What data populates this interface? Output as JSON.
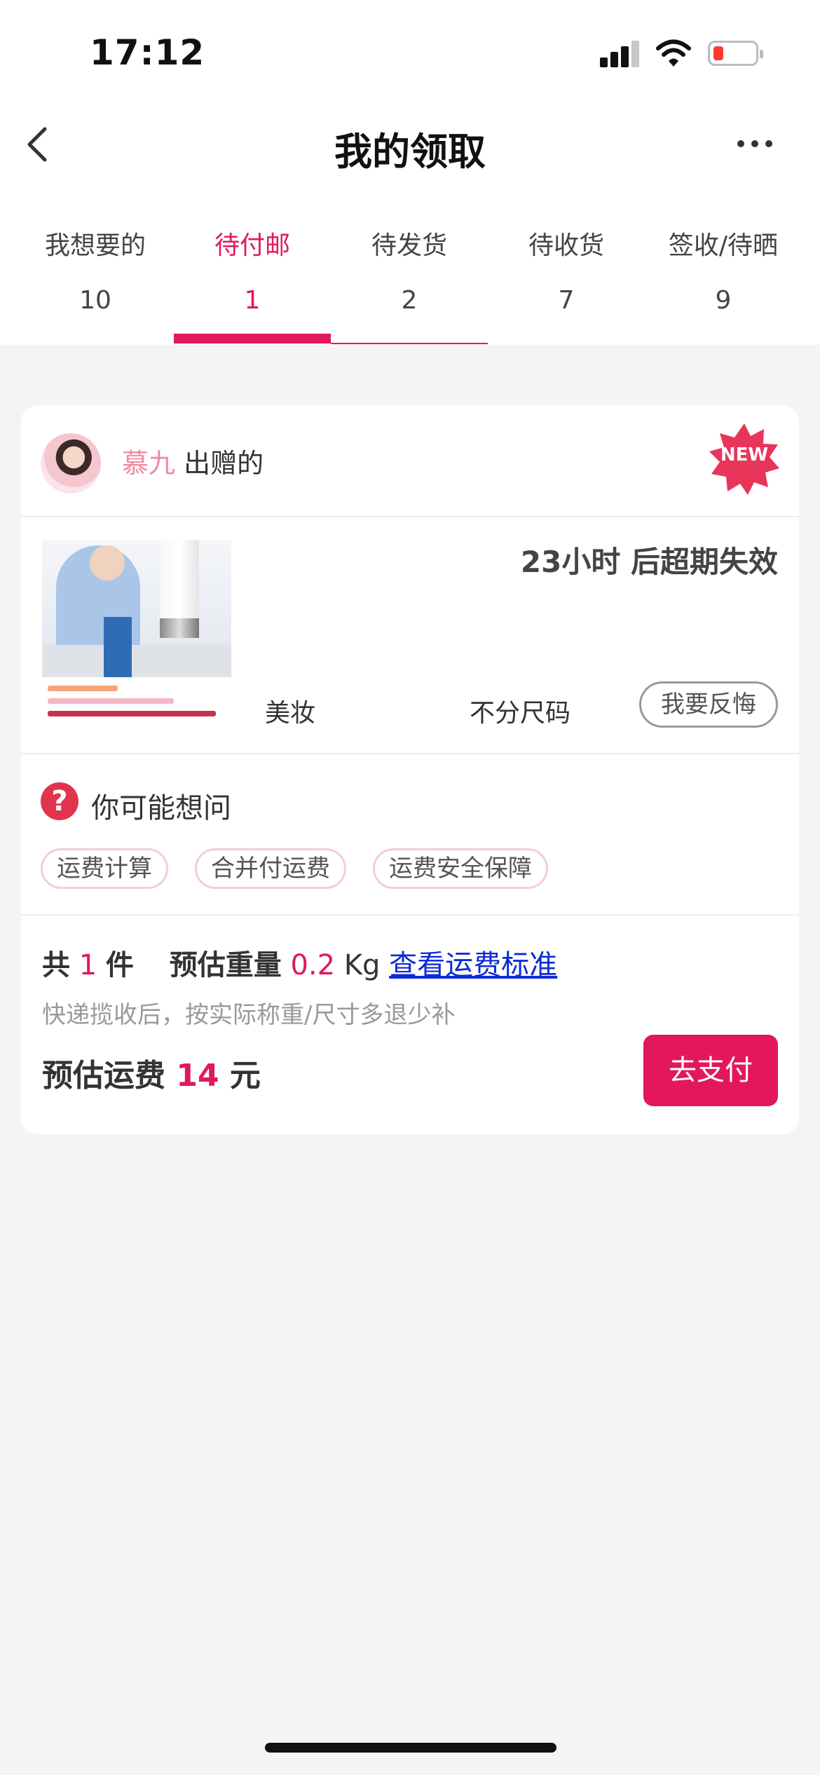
{
  "status_bar": {
    "time": "17:12"
  },
  "nav": {
    "title": "我的领取"
  },
  "tabs": [
    {
      "label": "我想要的",
      "count": "10"
    },
    {
      "label": "待付邮",
      "count": "1"
    },
    {
      "label": "待发货",
      "count": "2"
    },
    {
      "label": "待收货",
      "count": "7"
    },
    {
      "label": "签收/待晒",
      "count": "9"
    }
  ],
  "active_tab_index": 1,
  "card": {
    "giver_name": "慕九",
    "giver_suffix": " 出赠的",
    "badge": "NEW",
    "expire_text": "23小时 后超期失效",
    "category": "美妆",
    "size": "不分尺码",
    "regret_button": "我要反悔",
    "faq": {
      "title": "你可能想问",
      "chips": [
        "运费计算",
        "合并付运费",
        "运费安全保障"
      ]
    },
    "summary": {
      "count_prefix": "共",
      "count": "1",
      "count_suffix": "件",
      "weight_label": "预估重量",
      "weight": "0.2",
      "weight_unit": "Kg",
      "link": "查看运费标准",
      "note": "快递揽收后，按实际称重/尺寸多退少补",
      "fee_label": "预估运费",
      "fee": "14",
      "fee_unit": "元",
      "pay_button": "去支付"
    }
  },
  "colors": {
    "accent": "#e2185b",
    "link": "#0d2bd6",
    "background": "#f4f4f4"
  },
  "icons": [
    "back-chevron-icon",
    "more-dots-icon",
    "signal-icon",
    "wifi-icon",
    "battery-icon",
    "question-icon",
    "new-badge-icon"
  ]
}
